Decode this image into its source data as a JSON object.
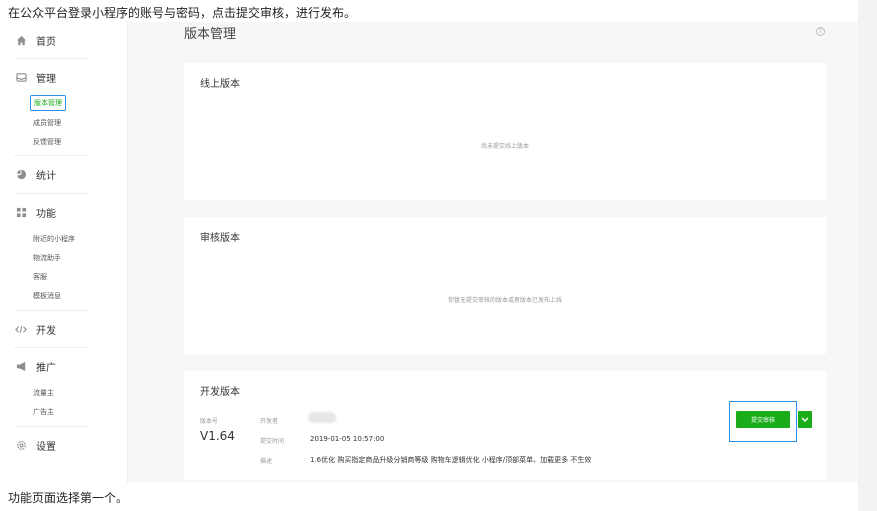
{
  "captions": {
    "top": "在公众平台登录小程序的账号与密码，点击提交审核，进行发布。",
    "bottom": "功能页面选择第一个。"
  },
  "sidebar": {
    "groups": [
      {
        "label": "首页",
        "icon": "home-icon"
      },
      {
        "label": "管理",
        "icon": "inbox-icon",
        "items": [
          "版本管理",
          "成员管理",
          "反馈管理"
        ]
      },
      {
        "label": "统计",
        "icon": "pie-chart-icon"
      },
      {
        "label": "功能",
        "icon": "grid-icon",
        "items": [
          "附近的小程序",
          "物流助手",
          "客服",
          "模板消息"
        ]
      },
      {
        "label": "开发",
        "icon": "code-icon"
      },
      {
        "label": "推广",
        "icon": "megaphone-icon",
        "items": [
          "流量主",
          "广告主"
        ]
      },
      {
        "label": "设置",
        "icon": "gear-icon"
      }
    ],
    "active_item": "版本管理"
  },
  "page": {
    "title": "版本管理"
  },
  "online": {
    "title": "线上版本",
    "empty": "尚未提交线上版本"
  },
  "review": {
    "title": "审核版本",
    "empty": "你暂无提交审核的版本或者版本已发布上线"
  },
  "dev": {
    "title": "开发版本",
    "version_label": "版本号",
    "version_value": "V1.64",
    "developer_label": "开发者",
    "submit_time_label": "提交时间",
    "submit_time_value": "2019-01-05 10:57:00",
    "desc_label": "描述",
    "desc_value": "1.6优化 购买指定商品升级分销商等级 购物车逻辑优化 小程序/顶部菜单、加载更多 不生效",
    "submit_button": "提交审核"
  },
  "colors": {
    "accent_green": "#1aad19",
    "highlight_blue": "#2b8fe6"
  }
}
